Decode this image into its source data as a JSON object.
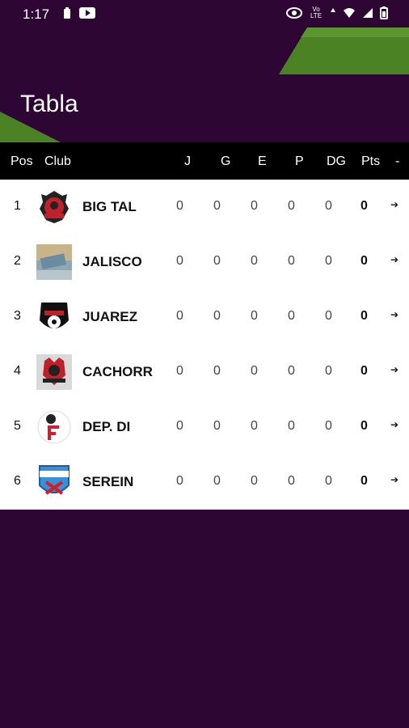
{
  "status": {
    "time": "1:17",
    "network_label": "Vo LTE"
  },
  "page": {
    "title": "Tabla"
  },
  "table": {
    "headers": [
      "Pos",
      "Club",
      "J",
      "G",
      "E",
      "P",
      "DG",
      "Pts",
      "-"
    ],
    "rows": [
      {
        "pos": "1",
        "club": "BIG TAL",
        "j": "0",
        "g": "0",
        "e": "0",
        "p": "0",
        "dg": "0",
        "pts": "0"
      },
      {
        "pos": "2",
        "club": "JALISCO",
        "j": "0",
        "g": "0",
        "e": "0",
        "p": "0",
        "dg": "0",
        "pts": "0"
      },
      {
        "pos": "3",
        "club": "JUAREZ",
        "j": "0",
        "g": "0",
        "e": "0",
        "p": "0",
        "dg": "0",
        "pts": "0"
      },
      {
        "pos": "4",
        "club": "CACHORR",
        "j": "0",
        "g": "0",
        "e": "0",
        "p": "0",
        "dg": "0",
        "pts": "0"
      },
      {
        "pos": "5",
        "club": "DEP. DI",
        "j": "0",
        "g": "0",
        "e": "0",
        "p": "0",
        "dg": "0",
        "pts": "0"
      },
      {
        "pos": "6",
        "club": "SEREIN",
        "j": "0",
        "g": "0",
        "e": "0",
        "p": "0",
        "dg": "0",
        "pts": "0"
      }
    ]
  },
  "colors": {
    "background": "#2d0634",
    "accent_green": "#4e8a25",
    "header_bg": "#000000",
    "table_bg": "#ffffff"
  }
}
